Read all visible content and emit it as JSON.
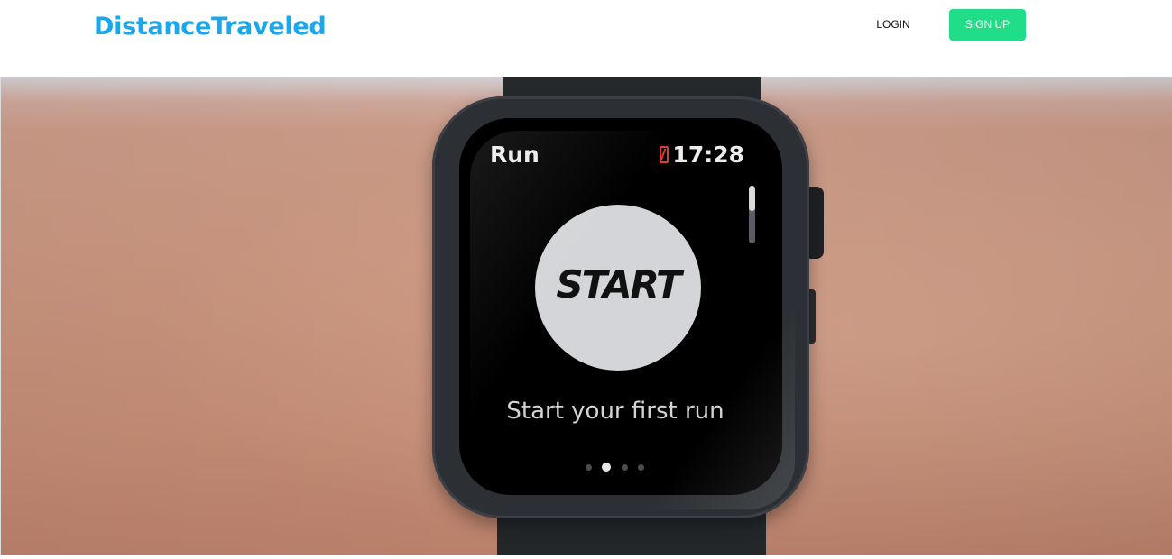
{
  "header": {
    "brand": "DistanceTraveled",
    "login_label": "LOGIN",
    "signup_label": "SIGN UP"
  },
  "hero": {
    "watch": {
      "app_title": "Run",
      "clock": "17:28",
      "start_label": "START",
      "caption": "Start your first run",
      "page_dots": {
        "count": 4,
        "active_index": 1
      }
    }
  },
  "colors": {
    "brand": "#1aa7ec",
    "signup_bg": "#22dd88",
    "battery_low": "#e23a2b"
  },
  "icons": {
    "battery": "low-battery-icon"
  }
}
